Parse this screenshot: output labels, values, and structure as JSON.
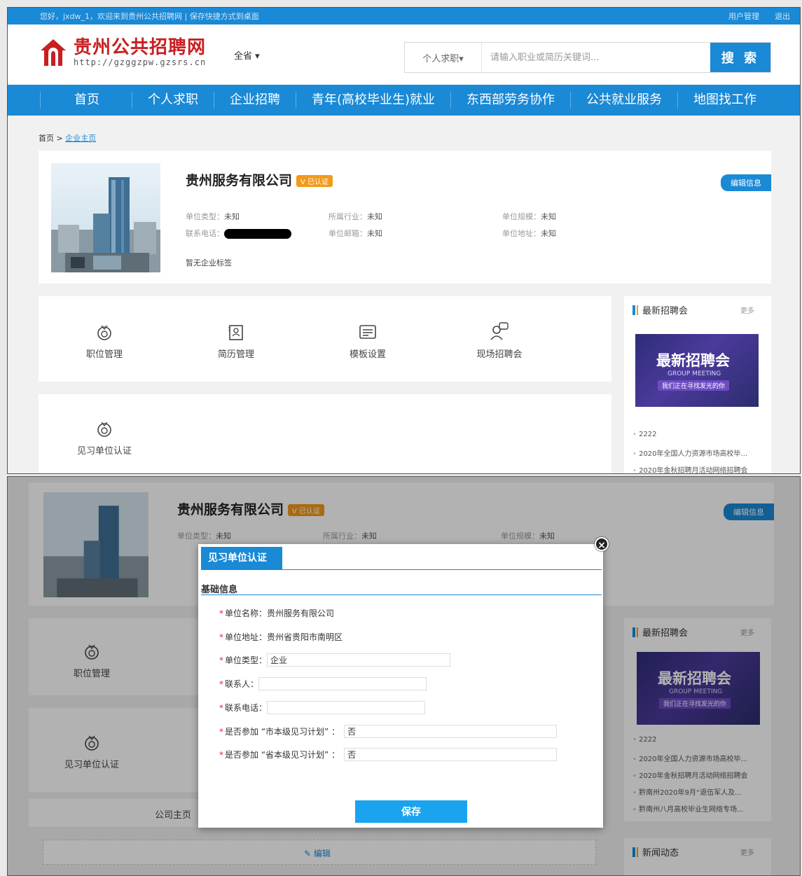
{
  "topbar": {
    "welcome": "您好，jxdw_1，欢迎来到贵州公共招聘网 | 保存快捷方式到桌面",
    "user_manage": "用户管理",
    "logout": "退出"
  },
  "header": {
    "site_name": "贵州公共招聘网",
    "site_url": "http://gzggzpw.gzsrs.cn",
    "region": "全省 ▾",
    "search_type": "个人求职▾",
    "search_placeholder": "请输入职业或简历关键词...",
    "search_button": "搜 索"
  },
  "nav": [
    "首页",
    "个人求职",
    "企业招聘",
    "青年(高校毕业生)就业",
    "东西部劳务协作",
    "公共就业服务",
    "地图找工作"
  ],
  "breadcrumb": {
    "home": "首页",
    "sep": ">",
    "current": "企业主页"
  },
  "company": {
    "name": "贵州服务有限公司",
    "verified": "V 已认证",
    "edit_button": "编辑信息",
    "fields": [
      {
        "label": "单位类型：",
        "value": "未知"
      },
      {
        "label": "所属行业：",
        "value": "未知"
      },
      {
        "label": "单位规模：",
        "value": "未知"
      },
      {
        "label": "联系电话：",
        "value": ""
      },
      {
        "label": "单位邮箱：",
        "value": "未知"
      },
      {
        "label": "单位地址：",
        "value": "未知"
      }
    ],
    "no_tags": "暂无企业标签"
  },
  "tools": [
    "职位管理",
    "简历管理",
    "模板设置",
    "现场招聘会"
  ],
  "tools2": [
    "见习单位认证"
  ],
  "sidebar": {
    "title": "最新招聘会",
    "more": "更多",
    "banner_title": "最新招聘会",
    "banner_sub": "GROUP MEETING",
    "banner_slogan": "我们正在寻找发光的你",
    "news_top": [
      "2222",
      "2020年全国人力资源市场高校毕...",
      "2020年金秋招聘月活动网络招聘会"
    ],
    "news_bottom": [
      "2222",
      "2020年全国人力资源市场高校毕...",
      "2020年金秋招聘月活动网络招聘会",
      "黔南州2020年9月“退伍军人及...",
      "黔南州八月高校毕业生网络专场..."
    ],
    "news_title": "新闻动态"
  },
  "bottom_bg": {
    "tab_home": "公司主页",
    "edit": "✎ 编辑"
  },
  "modal": {
    "tab": "见习单位认证",
    "close": "×",
    "section": "基础信息",
    "name_label": "单位名称：",
    "name_value": "贵州服务有限公司",
    "addr_label": "单位地址：",
    "addr_value": "贵州省贵阳市南明区",
    "type_label": "单位类型：",
    "type_value": "企业",
    "contact_label": "联系人：",
    "contact_value": "",
    "phone_label": "联系电话：",
    "phone_value": "",
    "city_plan_label": "是否参加 “市本级见习计划” ：",
    "city_plan_value": "否",
    "prov_plan_label": "是否参加 “省本级见习计划” ：",
    "prov_plan_value": "否",
    "req_mark": "*",
    "save": "保存"
  },
  "colors": {
    "brand": "#1a89d6",
    "logo_red": "#c81f22",
    "badge": "#f29a1b"
  }
}
